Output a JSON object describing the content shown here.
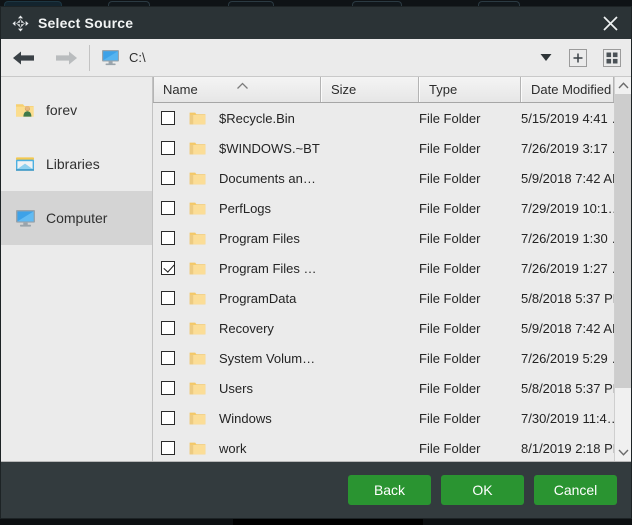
{
  "window": {
    "title": "Select Source",
    "title_icon": "move-four-arrows-icon",
    "close_icon": "close-icon"
  },
  "toolbar": {
    "back_icon": "arrow-left-icon",
    "forward_icon": "arrow-right-icon",
    "path_icon": "computer-monitor-icon",
    "path_value": "C:\\",
    "path_placeholder": "C:\\",
    "dropdown_icon": "chevron-down-icon",
    "new_folder_icon": "plus-icon",
    "view_icon": "grid-view-icon"
  },
  "sidebar": {
    "items": [
      {
        "label": "forev",
        "icon": "user-folder-icon",
        "selected": false
      },
      {
        "label": "Libraries",
        "icon": "libraries-icon",
        "selected": false
      },
      {
        "label": "Computer",
        "icon": "computer-monitor-icon",
        "selected": true
      }
    ]
  },
  "file_list": {
    "columns": [
      {
        "label": "Name",
        "sorted": "asc"
      },
      {
        "label": "Size",
        "sorted": ""
      },
      {
        "label": "Type",
        "sorted": ""
      },
      {
        "label": "Date Modified",
        "sorted": ""
      }
    ],
    "sort_icon": "caret-up-icon",
    "rows": [
      {
        "checked": false,
        "name": "$Recycle.Bin",
        "size": "",
        "type": "File Folder",
        "date": "5/15/2019 4:41 …"
      },
      {
        "checked": false,
        "name": "$WINDOWS.~BT",
        "size": "",
        "type": "File Folder",
        "date": "7/26/2019 3:17 …"
      },
      {
        "checked": false,
        "name": "Documents an…",
        "size": "",
        "type": "File Folder",
        "date": "5/9/2018 7:42 AM"
      },
      {
        "checked": false,
        "name": "PerfLogs",
        "size": "",
        "type": "File Folder",
        "date": "7/29/2019 10:1…"
      },
      {
        "checked": false,
        "name": "Program Files",
        "size": "",
        "type": "File Folder",
        "date": "7/26/2019 1:30 …"
      },
      {
        "checked": true,
        "name": "Program Files …",
        "size": "",
        "type": "File Folder",
        "date": "7/26/2019 1:27 …"
      },
      {
        "checked": false,
        "name": "ProgramData",
        "size": "",
        "type": "File Folder",
        "date": "5/8/2018 5:37 PM"
      },
      {
        "checked": false,
        "name": "Recovery",
        "size": "",
        "type": "File Folder",
        "date": "5/9/2018 7:42 AM"
      },
      {
        "checked": false,
        "name": "System Volum…",
        "size": "",
        "type": "File Folder",
        "date": "7/26/2019 5:29 …"
      },
      {
        "checked": false,
        "name": "Users",
        "size": "",
        "type": "File Folder",
        "date": "5/8/2018 5:37 PM"
      },
      {
        "checked": false,
        "name": "Windows",
        "size": "",
        "type": "File Folder",
        "date": "7/30/2019 11:4…"
      },
      {
        "checked": false,
        "name": "work",
        "size": "",
        "type": "File Folder",
        "date": "8/1/2019 2:18 PM"
      },
      {
        "checked": false,
        "name": "",
        "size": "",
        "type": "",
        "date": ""
      }
    ],
    "scroll_up_icon": "caret-up-icon",
    "scroll_down_icon": "caret-down-icon"
  },
  "footer": {
    "back_label": "Back",
    "ok_label": "OK",
    "cancel_label": "Cancel"
  },
  "colors": {
    "chrome": "#333b3e",
    "titlebar": "#2b3336",
    "accent_green": "#2a9431",
    "panel": "#ebebeb",
    "selection": "#d4d4d4",
    "folder_yellow": "#fbd77f",
    "monitor_blue": "#3da2e8"
  }
}
